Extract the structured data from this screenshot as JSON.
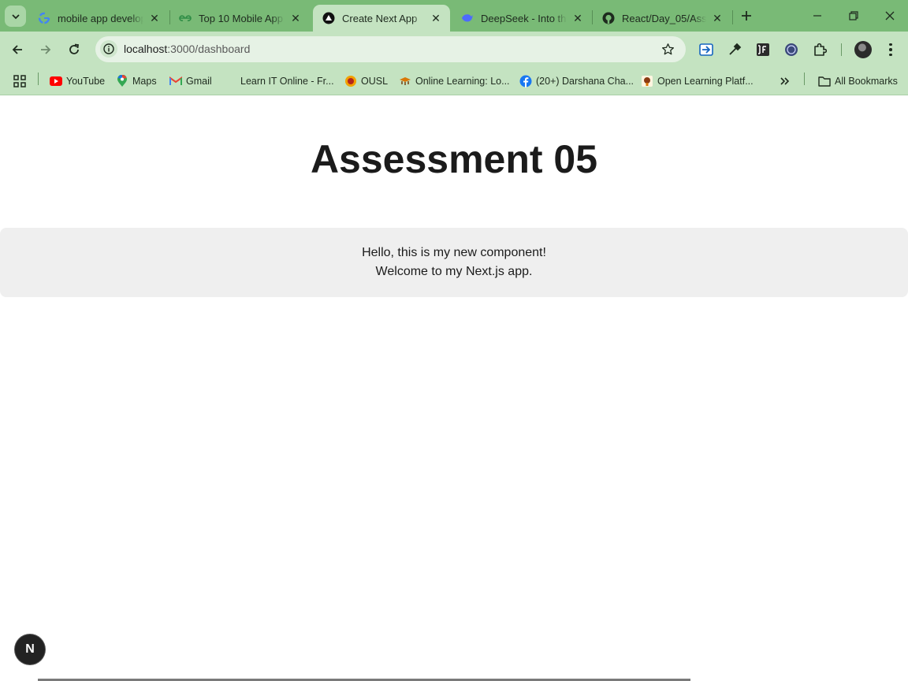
{
  "browser": {
    "tabs": [
      {
        "title": "mobile app develop",
        "favicon": "google-icon",
        "active": false
      },
      {
        "title": "Top 10 Mobile App D",
        "favicon": "geeksforgeeks-icon",
        "active": false
      },
      {
        "title": "Create Next App",
        "favicon": "nextjs-icon",
        "active": true
      },
      {
        "title": "DeepSeek - Into the",
        "favicon": "deepseek-icon",
        "active": false
      },
      {
        "title": "React/Day_05/Asses",
        "favicon": "github-icon",
        "active": false
      }
    ],
    "address_bar": {
      "host": "localhost",
      "path": ":3000/dashboard"
    },
    "bookmarks": [
      {
        "label": "YouTube",
        "icon": "youtube-icon"
      },
      {
        "label": "Maps",
        "icon": "maps-icon"
      },
      {
        "label": "Gmail",
        "icon": "gmail-icon"
      },
      {
        "label": "Learn IT Online - Fr...",
        "icon": "none"
      },
      {
        "label": "OUSL",
        "icon": "ousl-icon"
      },
      {
        "label": "Online Learning: Lo...",
        "icon": "mortarboard-icon"
      },
      {
        "label": "(20+) Darshana Cha...",
        "icon": "facebook-icon"
      },
      {
        "label": "Open Learning Platf...",
        "icon": "open-learning-icon"
      }
    ],
    "all_bookmarks_label": "All Bookmarks",
    "colors": {
      "frame": "#79ba76",
      "toolbar": "#c4e3c1"
    }
  },
  "page": {
    "title": "Assessment 05",
    "component": {
      "line1": "Hello, this is my new component!",
      "line2": "Welcome to my Next.js app."
    },
    "dev_badge": "N"
  }
}
